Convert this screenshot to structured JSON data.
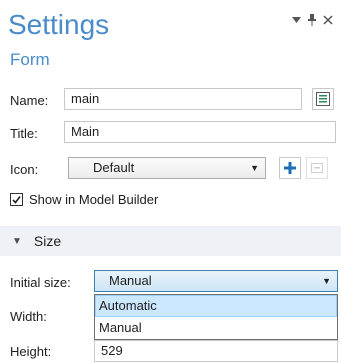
{
  "header": {
    "title": "Settings",
    "subtitle": "Form"
  },
  "fields": {
    "name": {
      "label": "Name:",
      "value": "main"
    },
    "title": {
      "label": "Title:",
      "value": "Main"
    },
    "icon": {
      "label": "Icon:",
      "selected": "Default"
    },
    "show_in_model_builder": {
      "label": "Show in Model Builder",
      "checked": true
    }
  },
  "size_section": {
    "title": "Size",
    "initial_size": {
      "label": "Initial size:",
      "selected": "Manual",
      "options": [
        "Automatic",
        "Manual"
      ]
    },
    "width": {
      "label": "Width:"
    },
    "height": {
      "label": "Height:",
      "value": "529"
    }
  },
  "icons": {
    "header_controls": [
      "dropdown-arrow-icon",
      "pin-icon",
      "close-icon"
    ],
    "name_action": "form-edit-icon",
    "add": "plus-icon",
    "disabled_action": "remove-icon"
  },
  "colors": {
    "accent": "#4a8bc9",
    "section_bg": "#eef2f7",
    "highlight": "#cce8ff"
  }
}
